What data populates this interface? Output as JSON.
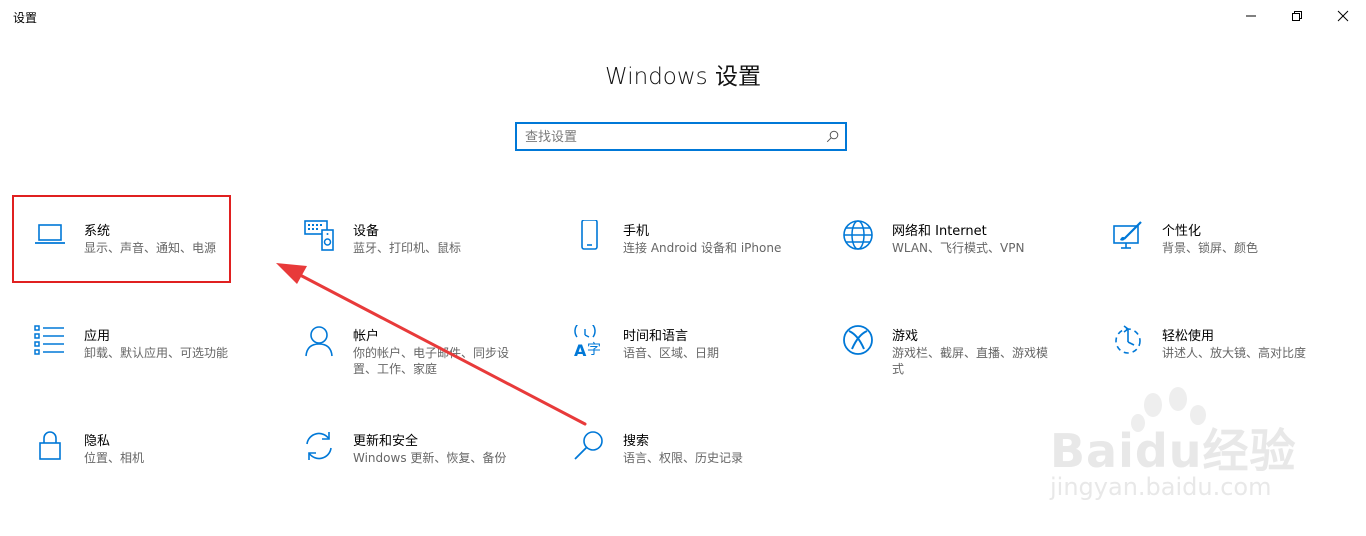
{
  "window": {
    "title": "设置",
    "controls": {
      "minimize": "minimize",
      "restore": "restore",
      "close": "close"
    }
  },
  "header": {
    "title": "Windows 设置",
    "search": {
      "placeholder": "查找设置",
      "value": ""
    }
  },
  "tiles": [
    {
      "label": "系统",
      "desc": "显示、声音、通知、电源",
      "icon": "laptop-icon"
    },
    {
      "label": "设备",
      "desc": "蓝牙、打印机、鼠标",
      "icon": "devices-icon"
    },
    {
      "label": "手机",
      "desc": "连接 Android 设备和 iPhone",
      "icon": "phone-icon"
    },
    {
      "label": "网络和 Internet",
      "desc": "WLAN、飞行模式、VPN",
      "icon": "globe-icon"
    },
    {
      "label": "个性化",
      "desc": "背景、锁屏、颜色",
      "icon": "personalization-icon"
    },
    {
      "label": "应用",
      "desc": "卸载、默认应用、可选功能",
      "icon": "apps-list-icon"
    },
    {
      "label": "帐户",
      "desc": "你的帐户、电子邮件、同步设置、工作、家庭",
      "icon": "person-icon"
    },
    {
      "label": "时间和语言",
      "desc": "语音、区域、日期",
      "icon": "time-language-icon"
    },
    {
      "label": "游戏",
      "desc": "游戏栏、截屏、直播、游戏模式",
      "icon": "xbox-icon"
    },
    {
      "label": "轻松使用",
      "desc": "讲述人、放大镜、高对比度",
      "icon": "ease-of-access-icon"
    },
    {
      "label": "隐私",
      "desc": "位置、相机",
      "icon": "lock-icon"
    },
    {
      "label": "更新和安全",
      "desc": "Windows 更新、恢复、备份",
      "icon": "sync-icon"
    },
    {
      "label": "搜索",
      "desc": "语言、权限、历史记录",
      "icon": "search-magnifier-icon"
    }
  ],
  "watermark": {
    "logo": "Baidu经验",
    "url": "jingyan.baidu.com"
  },
  "colors": {
    "accent": "#0078d7",
    "highlight": "#e02020",
    "text_secondary": "#666666"
  }
}
